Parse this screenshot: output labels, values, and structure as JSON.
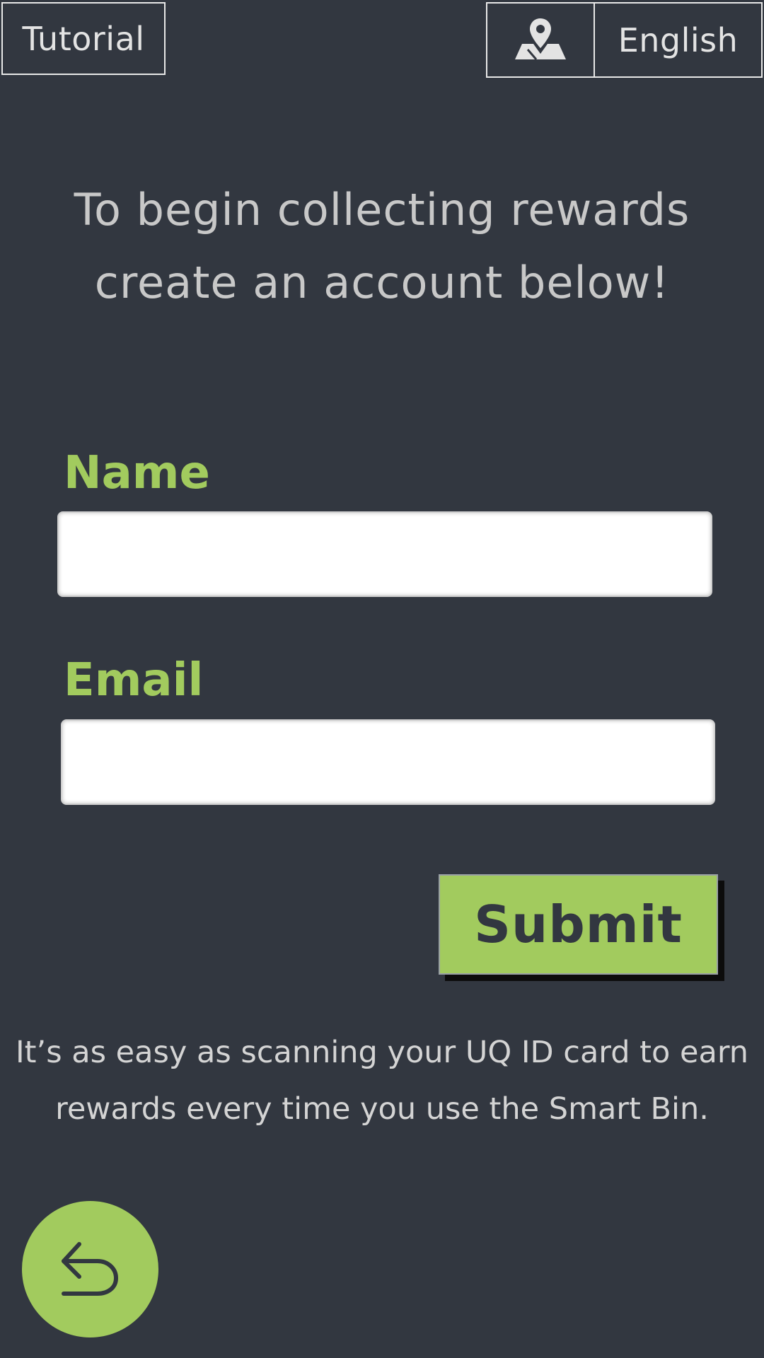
{
  "header": {
    "tutorial_label": "Tutorial",
    "map_icon": "map-pin-icon",
    "language_label": "English"
  },
  "main": {
    "headline_line1": "To begin collecting rewards",
    "headline_line2": "create an account below!"
  },
  "form": {
    "name_label": "Name",
    "name_value": "",
    "email_label": "Email",
    "email_value": "",
    "submit_label": "Submit"
  },
  "footer": {
    "info_line1": "It’s as easy as scanning your UQ ID card to earn",
    "info_line2": "rewards every time you use the Smart Bin.",
    "back_icon": "back-arrow-icon"
  },
  "colors": {
    "background": "#323740",
    "accent": "#a2cb5e",
    "text_light": "#e3e3e3"
  }
}
